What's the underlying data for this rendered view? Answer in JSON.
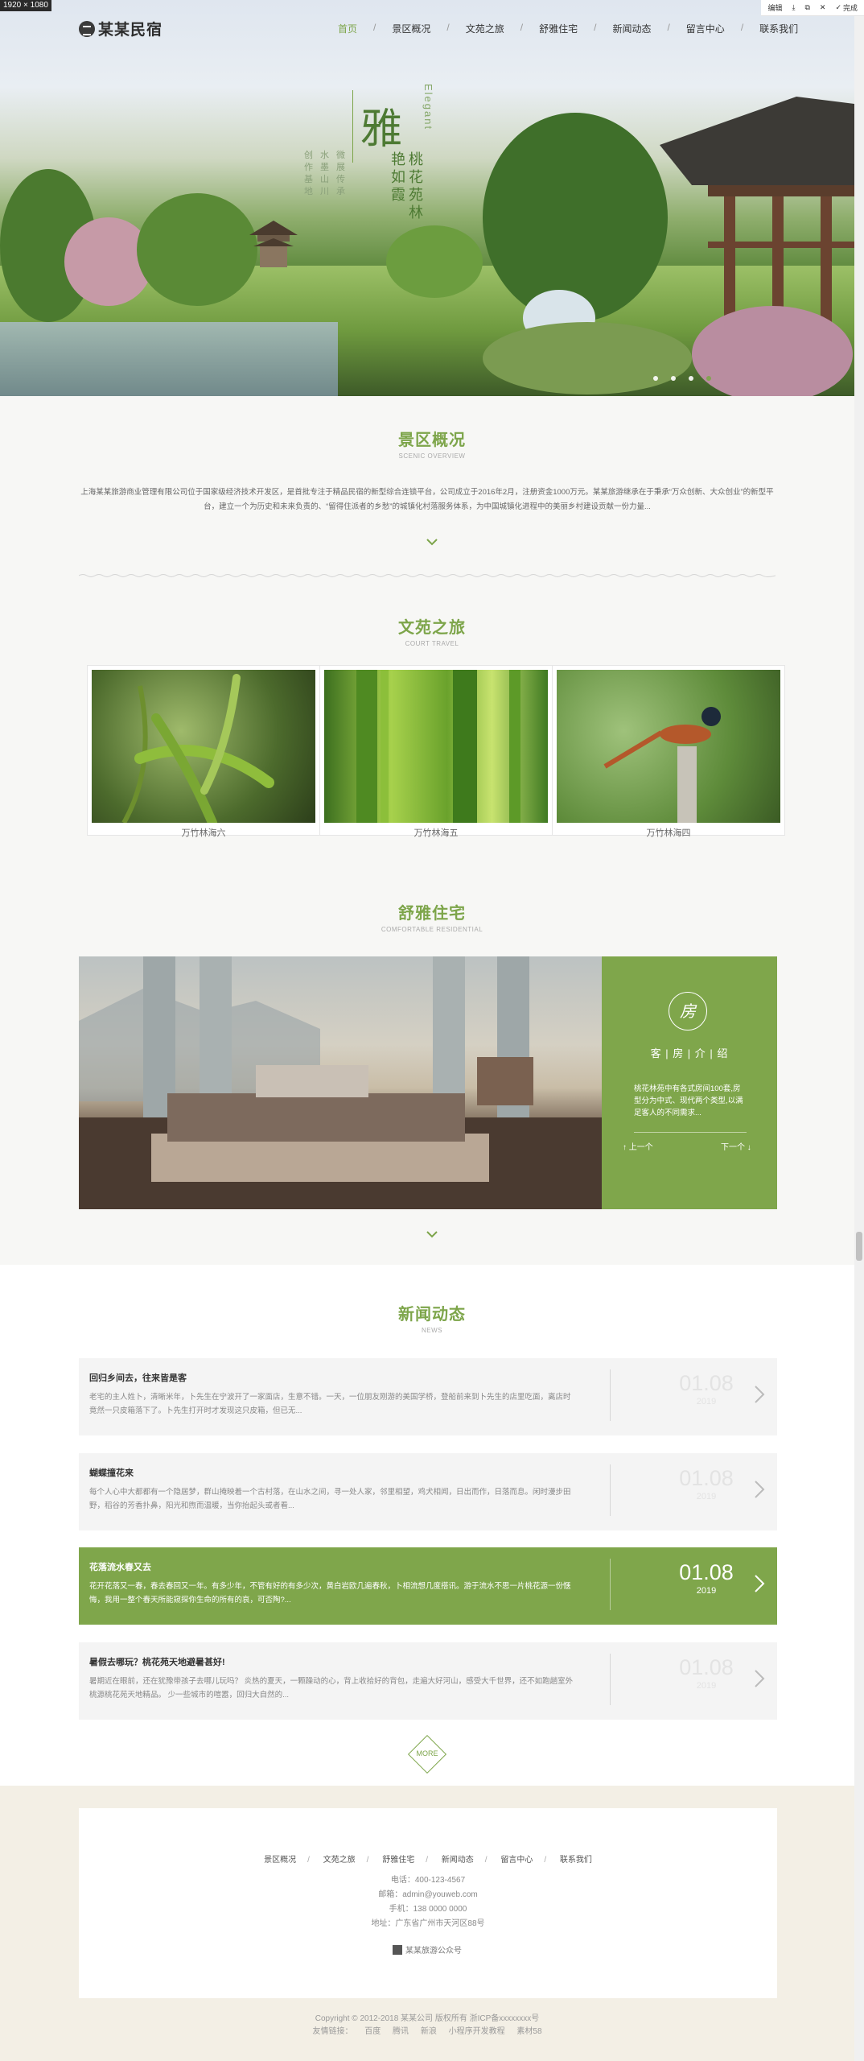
{
  "editor": {
    "size_tag": "1920 × 1080",
    "edit": "编辑",
    "download": "⤓",
    "copy": "⧉",
    "close": "✕",
    "done": "完成"
  },
  "nav": {
    "logo": "某某民宿",
    "items": [
      "首页",
      "景区概况",
      "文苑之旅",
      "舒雅住宅",
      "新闻动态",
      "留言中心",
      "联系我们"
    ]
  },
  "hero": {
    "big": "雅",
    "line1": "桃花苑林",
    "line2": "艳如霞",
    "left1": "微展传承",
    "left2": "水墨山川",
    "left3": "创作基地",
    "elegant": "Elegant"
  },
  "scenic": {
    "title": "景区概况",
    "sub": "SCENIC OVERVIEW",
    "text": "上海某某旅游商业管理有限公司位于国家级经济技术开发区，是首批专注于精品民宿的新型综合连锁平台，公司成立于2016年2月，注册资金1000万元。某某旅游继承在于秉承“万众创新、大众创业”的新型平台，建立一个为历史和未来负责的、“留得住派者的乡愁”的城镇化村落服务体系，为中国城镇化进程中的美丽乡村建设贡献一份力量..."
  },
  "culture": {
    "title": "文苑之旅",
    "sub": "COURT TRAVEL",
    "items": [
      "万竹林海六",
      "万竹林海五",
      "万竹林海四"
    ]
  },
  "residential": {
    "title": "舒雅住宅",
    "sub": "COMFORTABLE RESIDENTIAL",
    "icon": "房",
    "panel_title": "客 | 房 | 介 | 绍",
    "desc": "桃花林苑中有各式房间100套,房型分为中式、现代两个类型,以满足客人的不同需求...",
    "prev": "↑ 上一个",
    "next": "下一个 ↓"
  },
  "news": {
    "title": "新闻动态",
    "sub": "NEWS",
    "more": "MORE",
    "items": [
      {
        "title": "回归乡间去，往来皆是客",
        "text": "老宅的主人姓卜，清晰米年，卜先生在宁波开了一家面店，生意不错。一天，一位朋友刚游的美国学桥，登船前来到卜先生的店里吃面，离店时竟然一只皮箱落下了。卜先生打开时才发现这只皮箱，但已无...",
        "date": "01.08",
        "year": "2019"
      },
      {
        "title": "蝴蝶撞花来",
        "text": "每个人心中大都都有一个隐居梦，群山掩映着一个古村落，在山水之间，寻一处人家，邻里相望，鸡犬相闻，日出而作，日落而息。闲时漫步田野，稻谷的芳香扑鼻，阳光和煦而温暖，当你抬起头或者看...",
        "date": "01.08",
        "year": "2019"
      },
      {
        "title": "花落流水春又去",
        "text": "花开花落又一春，春去春回又一年。有多少年，不管有好的有多少次，黄白岩欧几遍春秋，卜相流想几度搭讯。游于流水不思一片桃花源一份惬悔，我用一整个春天所能窥探你生命的所有的哀，可否陶?...",
        "date": "01.08",
        "year": "2019"
      },
      {
        "title": "暑假去哪玩？桃花苑天地避暑甚好!",
        "text": "暑期近在眼前，还在犹豫带孩子去哪儿玩吗？ 炎热的夏天，一颗躁动的心，背上收拾好的背包，走遍大好河山，感受大千世界，还不如跑趟室外桃源桃花苑天地精品。 少一些城市的喧嚣，回归大自然的...",
        "date": "01.08",
        "year": "2019"
      }
    ]
  },
  "footer": {
    "links": [
      "景区概况",
      "文苑之旅",
      "舒雅住宅",
      "新闻动态",
      "留言中心",
      "联系我们"
    ],
    "phone": "电话：400-123-4567",
    "email": "邮箱：admin@youweb.com",
    "mobile": "手机：138 0000 0000",
    "address": "地址：广东省广州市天河区88号",
    "wx": "某某旅游公众号",
    "copyright": "Copyright © 2012-2018 某某公司 版权所有  浙ICP备xxxxxxxx号",
    "friend_label": "友情链接：",
    "friends": [
      "百度",
      "腾讯",
      "新浪",
      "小程序开发教程",
      "素材58"
    ]
  },
  "colors": {
    "accent": "#7fa64b"
  }
}
